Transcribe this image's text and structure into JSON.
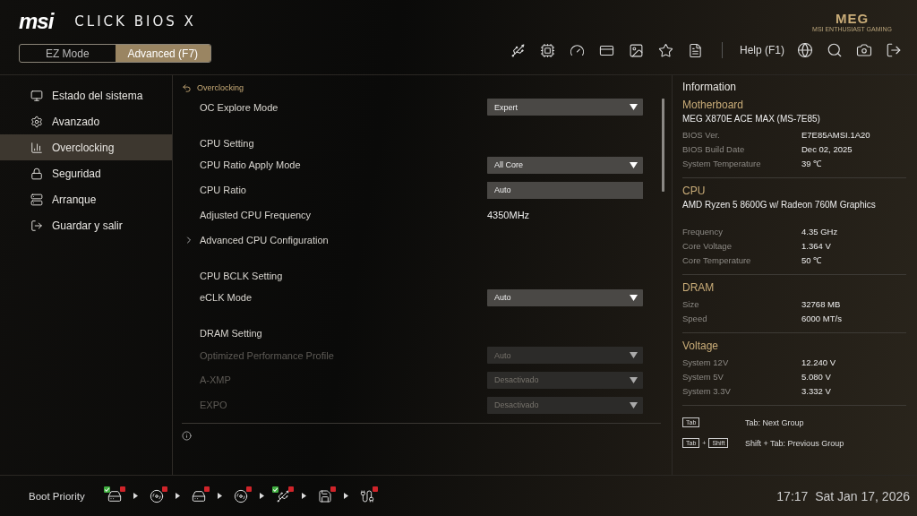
{
  "header": {
    "logo": "msi",
    "product": "CLICK BIOS X",
    "brand": {
      "mark": "MEG",
      "tagline": "MSI ENTHUSIAST GAMING"
    },
    "modes": [
      {
        "label": "EZ Mode",
        "selected": false
      },
      {
        "label": "Advanced (F7)",
        "selected": true
      }
    ],
    "help": "Help (F1)"
  },
  "sidebar": {
    "items": [
      {
        "label": "Estado del sistema",
        "selected": false
      },
      {
        "label": "Avanzado",
        "selected": false
      },
      {
        "label": "Overclocking",
        "selected": true
      },
      {
        "label": "Seguridad",
        "selected": false
      },
      {
        "label": "Arranque",
        "selected": false
      },
      {
        "label": "Guardar y salir",
        "selected": false
      }
    ]
  },
  "settings": {
    "breadcrumb": "Overclocking",
    "rows": [
      {
        "kind": "dropdown",
        "label": "OC Explore Mode",
        "value": "Expert",
        "disabled": false
      },
      {
        "kind": "heading",
        "label": "CPU Setting"
      },
      {
        "kind": "dropdown",
        "label": "CPU Ratio Apply Mode",
        "value": "All Core",
        "disabled": false
      },
      {
        "kind": "input",
        "label": "CPU Ratio",
        "value": "Auto",
        "disabled": false
      },
      {
        "kind": "value",
        "label": "Adjusted CPU Frequency",
        "value": "4350MHz"
      },
      {
        "kind": "submenu",
        "label": "Advanced CPU Configuration"
      },
      {
        "kind": "heading",
        "label": "CPU BCLK Setting"
      },
      {
        "kind": "dropdown",
        "label": "eCLK Mode",
        "value": "Auto",
        "disabled": false
      },
      {
        "kind": "heading",
        "label": "DRAM Setting"
      },
      {
        "kind": "dropdown",
        "label": "Optimized Performance Profile",
        "value": "Auto",
        "disabled": true
      },
      {
        "kind": "dropdown",
        "label": "A-XMP",
        "value": "Desactivado",
        "disabled": true
      },
      {
        "kind": "dropdown",
        "label": "EXPO",
        "value": "Desactivado",
        "disabled": true
      }
    ]
  },
  "information": {
    "title": "Information",
    "sections": [
      {
        "title": "Motherboard",
        "subtitle": "MEG X870E ACE MAX (MS-7E85)",
        "rows": [
          {
            "label": "BIOS Ver.",
            "value": "E7E85AMSI.1A20"
          },
          {
            "label": "BIOS Build Date",
            "value": "Dec 02, 2025"
          },
          {
            "label": "System Temperature",
            "value": "39 ℃"
          }
        ]
      },
      {
        "title": "CPU",
        "subtitle": "AMD Ryzen 5 8600G w/ Radeon 760M Graphics",
        "rows": [
          {
            "label": "Frequency",
            "value": "4.35 GHz"
          },
          {
            "label": "Core Voltage",
            "value": "1.364 V"
          },
          {
            "label": "Core Temperature",
            "value": "50 ℃"
          }
        ]
      },
      {
        "title": "DRAM",
        "rows": [
          {
            "label": "Size",
            "value": "32768 MB"
          },
          {
            "label": "Speed",
            "value": "6000 MT/s"
          }
        ]
      },
      {
        "title": "Voltage",
        "rows": [
          {
            "label": "System 12V",
            "value": "12.240 V"
          },
          {
            "label": "System 5V",
            "value": "5.080 V"
          },
          {
            "label": "System 3.3V",
            "value": "3.332 V"
          }
        ]
      }
    ],
    "hints": [
      {
        "keys": [
          "Tab"
        ],
        "text": "Tab: Next Group"
      },
      {
        "keys": [
          "Tab",
          "Shift"
        ],
        "joiner": "+",
        "text": "Shift + Tab: Previous Group"
      }
    ]
  },
  "footer": {
    "boot_label": "Boot Priority",
    "boot_devices": [
      {
        "kind": "hdd",
        "verified": true
      },
      {
        "kind": "disc",
        "verified": false
      },
      {
        "kind": "hdd",
        "verified": false
      },
      {
        "kind": "disc",
        "verified": false
      },
      {
        "kind": "usb",
        "verified": true
      },
      {
        "kind": "floppy",
        "verified": false
      },
      {
        "kind": "network",
        "verified": false
      }
    ],
    "clock": "17:17  Sat Jan 17, 2026"
  }
}
